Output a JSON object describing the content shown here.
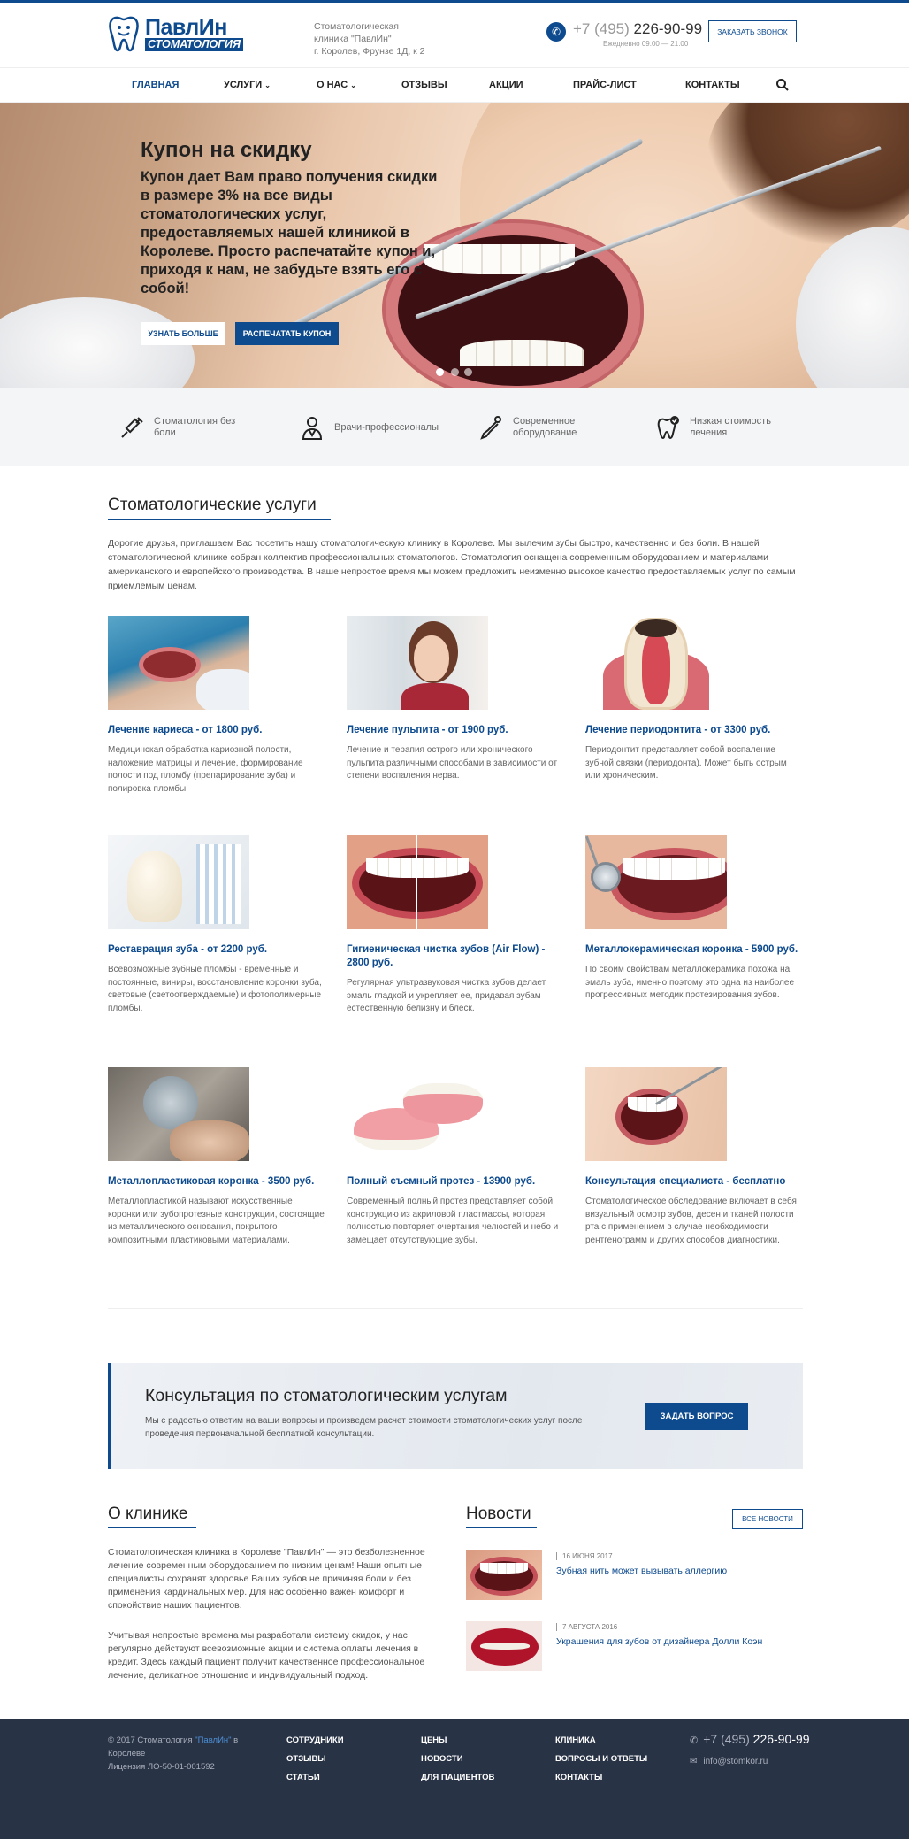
{
  "header": {
    "logo_top": "ПавлИн",
    "logo_bottom": "СТОМАТОЛОГИЯ",
    "clinic_line1": "Стоматологическая",
    "clinic_line2": "клиника \"ПавлИн\"",
    "clinic_line3": "г. Королев, Фрунзе 1Д, к 2",
    "phone_prefix": "+7 (495)",
    "phone_number": "226-90-99",
    "hours": "Ежедневно 09.00 — 21.00",
    "callback_label": "ЗАКАЗАТЬ ЗВОНОК",
    "accent": "#0d4a8e"
  },
  "nav": {
    "items": [
      "ГЛАВНАЯ",
      "УСЛУГИ",
      "О НАС",
      "ОТЗЫВЫ",
      "АКЦИИ",
      "ПРАЙС-ЛИСТ",
      "КОНТАКТЫ"
    ],
    "active": "ГЛАВНАЯ",
    "dropdown_items": [
      "УСЛУГИ",
      "О НАС"
    ],
    "search_icon": "search-icon"
  },
  "hero": {
    "title": "Купон на скидку",
    "text": "Купон дает Вам право получения скидки в размере 3% на все виды стоматологических услуг, предоставляемых нашей клиникой в Королеве. Просто распечатайте купон и, приходя к нам, не забудьте взять его с собой!",
    "btn_more": "УЗНАТЬ БОЛЬШЕ",
    "btn_print": "РАСПЕЧАТАТЬ КУПОН",
    "slides_count": 3,
    "active_slide": 1
  },
  "features": [
    {
      "icon": "syringe-icon",
      "label": "Стоматология без боли"
    },
    {
      "icon": "doctor-icon",
      "label": "Врачи-профессионалы"
    },
    {
      "icon": "dental-drill-icon",
      "label": "Современное оборудование"
    },
    {
      "icon": "tooth-check-icon",
      "label": "Низкая стоимость лечения"
    }
  ],
  "services": {
    "title": "Стоматологические услуги",
    "intro": "Дорогие друзья, приглашаем Вас посетить нашу стоматологическую клинику в Королеве. Мы вылечим зубы быстро, качественно и без боли. В нашей стоматологической клинике собран коллектив профессиональных стоматологов. Стоматология оснащена современным оборудованием и материалами американского и европейского производства. В наше непростое время мы можем предложить неизменно высокое качество предоставляемых услуг по самым приемлемым ценам.",
    "items": [
      {
        "title": "Лечение кариеса - от 1800 руб.",
        "desc": "Медицинская обработка кариозной полости, наложение матрицы и лечение, формирование полости под пломбу (препарирование зуба) и полировка пломбы."
      },
      {
        "title": "Лечение пульпита - от 1900 руб.",
        "desc": "Лечение и терапия острого или хронического пульпита различными способами в зависимости от степени воспаления нерва."
      },
      {
        "title": "Лечение периодонтита - от 3300 руб.",
        "desc": "Периодонтит представляет собой воспаление зубной связки (периодонта). Может быть острым или хроническим."
      },
      {
        "title": "Реставрация зуба - от 2200 руб.",
        "desc": "Всевозможные зубные пломбы - временные и постоянные, виниры, восстановление коронки зуба, световые (светоотверждаемые) и фотополимерные пломбы."
      },
      {
        "title": "Гигиеническая чистка зубов (Air Flow) - 2800 руб.",
        "desc": "Регулярная ультразвуковая чистка зубов делает эмаль гладкой и укрепляет ее, придавая зубам естественную белизну и блеск."
      },
      {
        "title": "Металлокерамическая коронка - 5900 руб.",
        "desc": "По своим свойствам металлокерамика похожа на эмаль зуба, именно поэтому это одна из наиболее прогрессивных методик протезирования зубов."
      },
      {
        "title": "Металлопластиковая коронка - 3500 руб.",
        "desc": "Металлопластикой называют искусственные коронки или зубопротезные конструкции, состоящие из металлического основания, покрытого композитными пластиковыми материалами."
      },
      {
        "title": "Полный съемный протез - 13900 руб.",
        "desc": "Современный полный протез представляет собой конструкцию из акриловой пластмассы, которая полностью повторяет очертания челюстей и небо и замещает отсутствующие зубы."
      },
      {
        "title": "Консультация специалиста - бесплатно",
        "desc": "Стоматологическое обследование включает в себя визуальный осмотр зубов, десен и тканей полости рта с применением в случае необходимости рентгенограмм и других способов диагностики."
      }
    ]
  },
  "consult": {
    "title": "Консультация по стоматологическим услугам",
    "text": "Мы с радостью ответим на ваши вопросы и произведем расчет стоимости стоматологических услуг после проведения первоначальной бесплатной консультации.",
    "button": "ЗАДАТЬ ВОПРОС"
  },
  "about": {
    "title": "О клинике",
    "p1": "Стоматологическая клиника в Королеве \"ПавлИн\" — это безболезненное лечение современным оборудованием по низким ценам! Наши опытные специалисты сохранят здоровье Ваших зубов не причиняя боли и без применения кардинальных мер. Для нас особенно важен комфорт и спокойствие наших пациентов.",
    "p2": "Учитывая непростые времена мы разработали систему скидок, у нас регулярно действуют всевозможные акции и система оплаты лечения в кредит. Здесь каждый пациент получит качественное профессиональное лечение, деликатное отношение и индивидуальный подход."
  },
  "news": {
    "title": "Новости",
    "all_label": "ВСЕ НОВОСТИ",
    "items": [
      {
        "date": "16 ИЮНЯ 2017",
        "title": "Зубная нить может вызывать аллергию"
      },
      {
        "date": "7 АВГУСТА 2016",
        "title": "Украшения для зубов от дизайнера Долли Коэн"
      }
    ]
  },
  "footer": {
    "copy_prefix": "© 2017 Стоматология",
    "copy_link": "\"ПавлИн\"",
    "copy_suffix": "в Королеве",
    "license": "Лицензия ЛО-50-01-001592",
    "col1": [
      "СОТРУДНИКИ",
      "ОТЗЫВЫ",
      "СТАТЬИ"
    ],
    "col2": [
      "ЦЕНЫ",
      "НОВОСТИ",
      "ДЛЯ ПАЦИЕНТОВ"
    ],
    "col3": [
      "КЛИНИКА",
      "ВОПРОСЫ И ОТВЕТЫ",
      "КОНТАКТЫ"
    ],
    "phone_prefix": "+7 (495)",
    "phone_number": "226-90-99",
    "email": "info@stomkor.ru",
    "bg": "#293346"
  }
}
